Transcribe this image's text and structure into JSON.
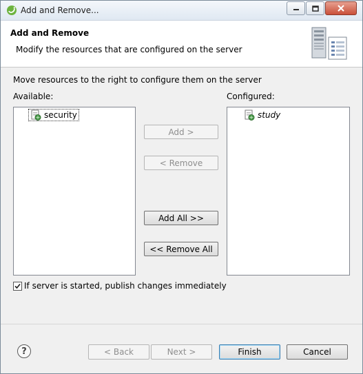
{
  "window": {
    "title": "Add and Remove..."
  },
  "header": {
    "title": "Add and Remove",
    "description": "Modify the resources that are configured on the server"
  },
  "main": {
    "instruction": "Move resources to the right to configure them on the server",
    "available_label": "Available:",
    "configured_label": "Configured:",
    "available_items": [
      "security"
    ],
    "configured_items": [
      "study"
    ]
  },
  "buttons": {
    "add": "Add >",
    "remove": "< Remove",
    "add_all": "Add All >>",
    "remove_all": "<< Remove All"
  },
  "options": {
    "publish_label": "If server is started, publish changes immediately",
    "publish_checked": true
  },
  "footer": {
    "back": "< Back",
    "next": "Next >",
    "finish": "Finish",
    "cancel": "Cancel",
    "help_icon_glyph": "?"
  },
  "colors": {
    "accent": "#3c7fb1",
    "disabled_text": "#8e8e8e"
  }
}
